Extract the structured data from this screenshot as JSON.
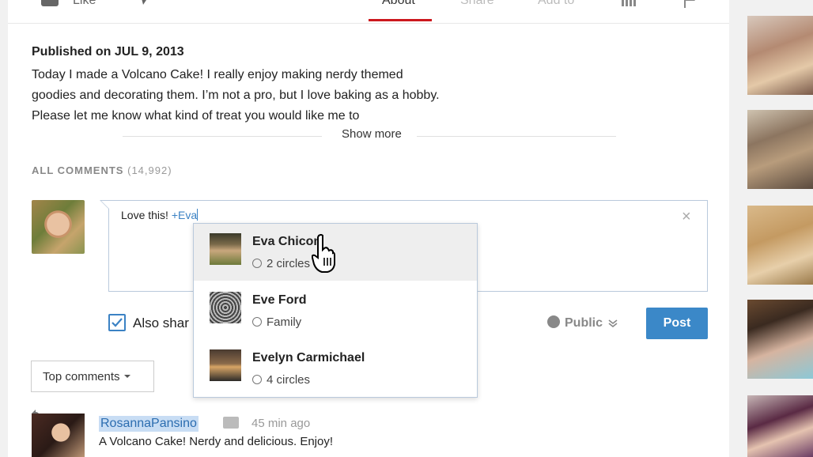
{
  "action_bar": {
    "like_label": "Like",
    "tabs": [
      {
        "label": "About",
        "active": true
      },
      {
        "label": "Share",
        "active": false
      },
      {
        "label": "Add to",
        "active": false
      }
    ]
  },
  "description": {
    "published": "Published on JUL 9, 2013",
    "text": "Today I made a Volcano Cake! I really enjoy making nerdy themed goodies and decorating them. I’m not a pro, but I love baking as a hobby. Please let me know what kind of treat you would like me to",
    "show_more": "Show more"
  },
  "comments_header": {
    "label": "ALL COMMENTS",
    "count": "(14,992)"
  },
  "compose": {
    "text": "Love this! ",
    "mention": "+Eva",
    "close_symbol": "×",
    "also_share_label": "Also shar",
    "visibility": "Public",
    "post_label": "Post"
  },
  "autocomplete": {
    "items": [
      {
        "name": "Eva Chicon",
        "circle": "2 circles",
        "active": true,
        "icon": "avatar-eva"
      },
      {
        "name": "Eve Ford",
        "circle": "Family",
        "active": false,
        "icon": "avatar-eve"
      },
      {
        "name": "Evelyn Carmichael",
        "circle": "4 circles",
        "active": false,
        "icon": "avatar-evelyn"
      }
    ]
  },
  "sort": {
    "label": "Top comments"
  },
  "first_comment": {
    "author": "RosannaPansino",
    "time": "45 min ago",
    "text": "A Volcano Cake! Nerdy and delicious. Enjoy!"
  },
  "colors": {
    "accent": "#cc181e",
    "post_button": "#3b88c8",
    "link": "#2c6db0"
  }
}
